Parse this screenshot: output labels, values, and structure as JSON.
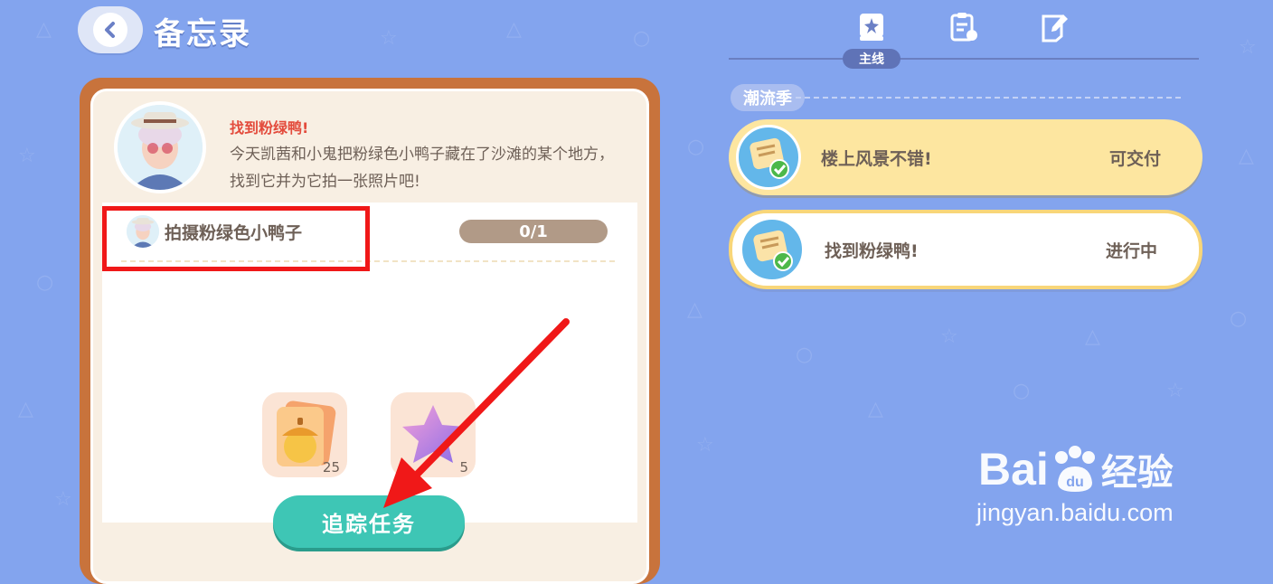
{
  "header": {
    "title": "备忘录"
  },
  "tabs": {
    "active_label": "主线",
    "icons": [
      "book-star-icon",
      "clipboard-refresh-icon",
      "note-edit-icon"
    ]
  },
  "section": {
    "label": "潮流季"
  },
  "quests": [
    {
      "name": "楼上风景不错!",
      "status": "可交付",
      "icon": "quest-scroll-icon"
    },
    {
      "name": "找到粉绿鸭!",
      "status": "进行中",
      "icon": "quest-scroll-icon"
    }
  ],
  "task": {
    "title": "找到粉绿鸭!",
    "description": "今天凯茜和小鬼把粉绿色小鸭子藏在了沙滩的某个地方，找到它并为它拍一张照片吧!",
    "subtask_label": "拍摄粉绿色小鸭子",
    "progress": "0/1",
    "rewards": [
      {
        "icon": "acorn-card-icon",
        "count": "25"
      },
      {
        "icon": "star-icon",
        "count": "5"
      }
    ],
    "track_button": "追踪任务"
  },
  "watermark": {
    "brand": "Bai",
    "brand_cn": "经验",
    "url": "jingyan.baidu.com"
  },
  "colors": {
    "background": "#83a4ee",
    "accent": "#3ec6b5",
    "highlight": "#f01818"
  }
}
